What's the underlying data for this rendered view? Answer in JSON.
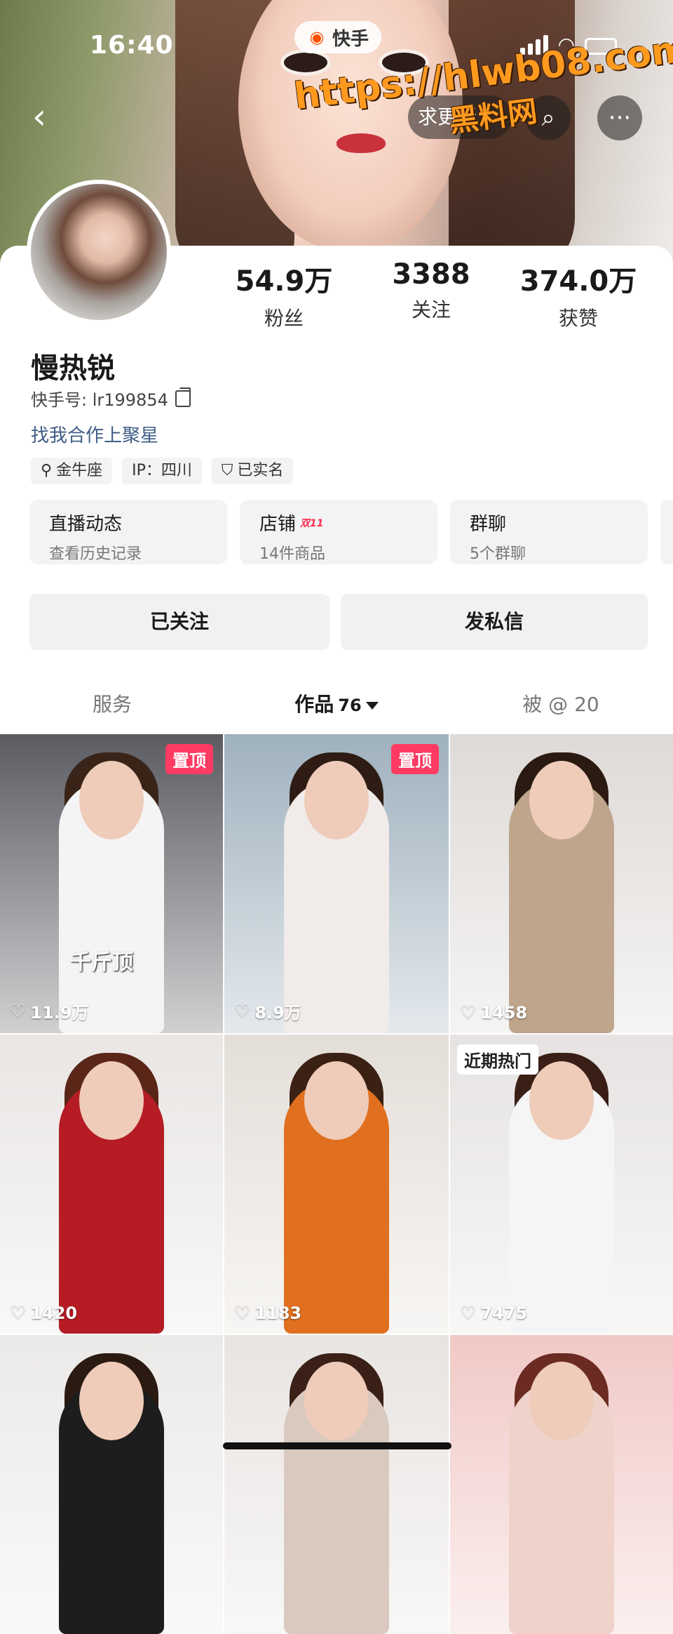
{
  "status_bar": {
    "time": "16:40"
  },
  "app_badge": {
    "label": "快手"
  },
  "watermark": {
    "url": "https://hlwb08.com",
    "site": "黑料网"
  },
  "header": {
    "pill_label": "求更新"
  },
  "profile": {
    "name": "慢热锐",
    "kuaishou_id": "快手号: lr199854",
    "coop_link": "找我合作上聚星",
    "stats": [
      {
        "value": "54.9万",
        "label": "粉丝"
      },
      {
        "value": "3388",
        "label": "关注"
      },
      {
        "value": "374.0万",
        "label": "获赞"
      }
    ],
    "tags": [
      {
        "icon": "search-icon",
        "text": "金牛座"
      },
      {
        "icon": "",
        "text": "IP：四川"
      },
      {
        "icon": "shield-check-icon",
        "text": "已实名"
      }
    ]
  },
  "tiles": [
    {
      "title": "直播动态",
      "subtitle": "查看历史记录",
      "badge": ""
    },
    {
      "title": "店铺",
      "subtitle": "14件商品",
      "badge": "双11"
    },
    {
      "title": "群聊",
      "subtitle": "5个群聊",
      "badge": ""
    }
  ],
  "actions": {
    "follow": "已关注",
    "message": "发私信"
  },
  "tabs": [
    {
      "label": "服务",
      "count": ""
    },
    {
      "label": "作品",
      "count": "76"
    },
    {
      "label": "被 @ 20",
      "count": ""
    }
  ],
  "videos": [
    {
      "likes": "11.9万",
      "badge": "置顶",
      "badge_type": "pin",
      "overlay": "千斤顶",
      "bg": "#5b5c62",
      "outfit": "#f4f4f4",
      "hair": "#3a2418"
    },
    {
      "likes": "8.9万",
      "badge": "置顶",
      "badge_type": "pin",
      "overlay": "",
      "bg": "#9fb1be",
      "outfit": "#f1ecea",
      "hair": "#2e1c14"
    },
    {
      "likes": "1458",
      "badge": "",
      "badge_type": "",
      "overlay": "",
      "bg": "#dedad7",
      "outfit": "#bfa58c",
      "hair": "#2a1a12"
    },
    {
      "likes": "1420",
      "badge": "",
      "badge_type": "",
      "overlay": "",
      "bg": "#e9e6e4",
      "outfit": "#b51c24",
      "hair": "#5a2618"
    },
    {
      "likes": "1183",
      "badge": "",
      "badge_type": "",
      "overlay": "",
      "bg": "#e4ded8",
      "outfit": "#e07020",
      "hair": "#3b2014"
    },
    {
      "likes": "7475",
      "badge": "近期热门",
      "badge_type": "hot",
      "overlay": "",
      "bg": "#e6e3e2",
      "outfit": "#f5f5f5",
      "hair": "#3a1f16"
    },
    {
      "likes": "",
      "badge": "",
      "badge_type": "",
      "overlay": "",
      "bg": "#eceae8",
      "outfit": "#1d1d1d",
      "hair": "#2a1a12"
    },
    {
      "likes": "",
      "badge": "",
      "badge_type": "",
      "overlay": "",
      "bg": "#e8e4e2",
      "outfit": "#d9c9be",
      "hair": "#3a2016"
    },
    {
      "likes": "",
      "badge": "",
      "badge_type": "",
      "overlay": "",
      "bg": "#f0c9c6",
      "outfit": "#efd3cb",
      "hair": "#6b2b22"
    }
  ],
  "colors": {
    "accent_pink": "#ff3b63",
    "link_blue": "#3f5d86",
    "brand_orange": "#ff5000"
  }
}
